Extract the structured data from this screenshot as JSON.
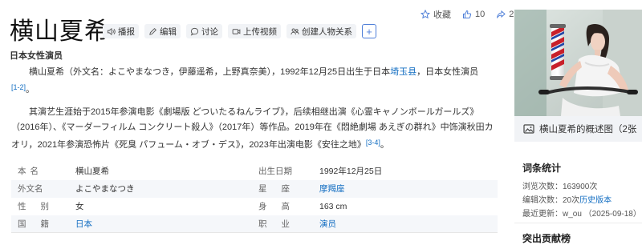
{
  "topbar": {
    "favorite_label": "收藏",
    "like_count": "10",
    "share_count": "2"
  },
  "entry": {
    "title": "横山夏希",
    "subtitle": "日本女性演员"
  },
  "actions": {
    "broadcast": "播报",
    "edit": "编辑",
    "discuss": "讨论",
    "upload_video": "上传视频",
    "create_relation": "创建人物关系",
    "add": "+"
  },
  "intro": {
    "p1_a": "横山夏希（外文名：よこやまなつき，伊藤遥希，上野真奈美），1992年12月25日出生于日本",
    "p1_link": "埼玉县",
    "p1_b": "，日本女性演员",
    "p1_ref": "[1-2]",
    "p1_end": "。",
    "p2": "其演艺生涯始于2015年参演电影《劇場版 どついたるねんライブ》，后续相继出演《心霊キャノンボールガールズ》（2016年）、《マーダーフィルム コンクリート殺人》（2017年）等作品。2019年在《悶絶劇場 あえぎの群れ》中饰演秋田カオリ，2021年参演恐怖片《死臭 パフューム・オブ・デス》，2023年出演电影《安往之地》",
    "p2_ref": "[3-4]",
    "p2_end": "。"
  },
  "infobox": {
    "rows": [
      {
        "l1": "本名",
        "v1": "横山夏希",
        "l2": "出生日期",
        "v2": "1992年12月25日"
      },
      {
        "l1": "外文名",
        "v1": "よこやまなつき",
        "l2": "星座",
        "v2": "摩羯座"
      },
      {
        "l1": "性别",
        "v1": "女",
        "l2": "身高",
        "v2": "163 cm"
      },
      {
        "l1": "国籍",
        "v1": "日本",
        "l2": "职业",
        "v2": "演员"
      }
    ]
  },
  "sidebar": {
    "caption": "横山夏希的概述图（2张",
    "stats_title": "词条统计",
    "views": "浏览次数：163900次",
    "edits_prefix": "编辑次数：20次",
    "edits_link": "历史版本",
    "last_update": "最近更新：w_ou （2025-09-18）",
    "contrib_title": "突出贡献榜"
  },
  "colors": {
    "link": "#136ec2",
    "button_bg": "#f1f3f6",
    "accent": "#4f7fd8"
  }
}
